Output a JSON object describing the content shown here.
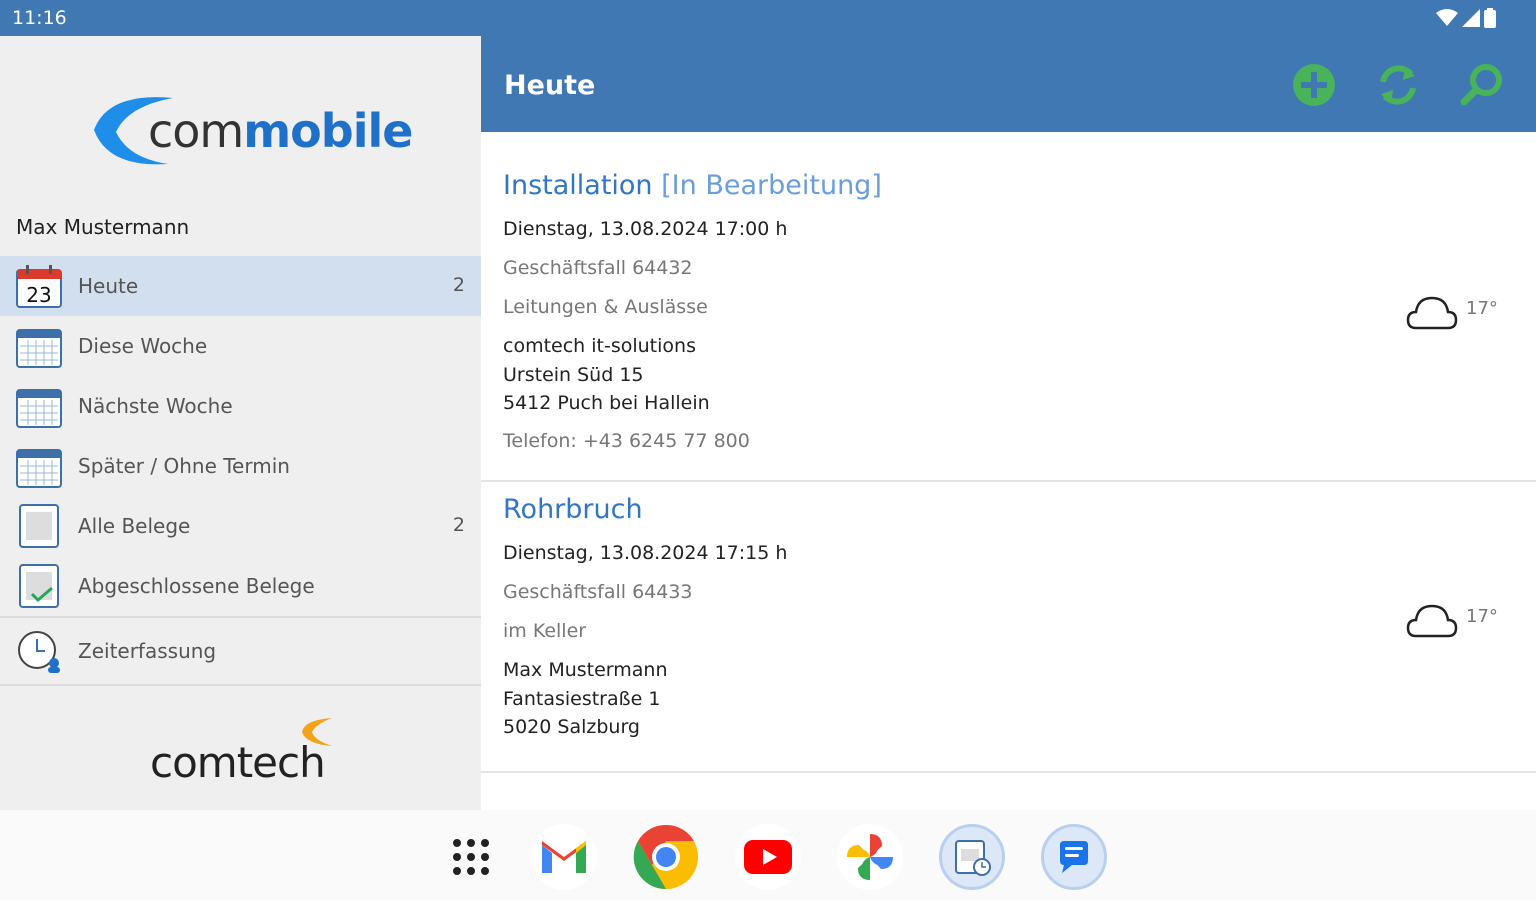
{
  "status": {
    "time": "11:16"
  },
  "drawer": {
    "logo_text_a": "com",
    "logo_text_b": "mobile",
    "user": "Max Mustermann",
    "items": [
      {
        "label": "Heute",
        "count": "2",
        "icon_day": "23",
        "active": true
      },
      {
        "label": "Diese Woche",
        "count": ""
      },
      {
        "label": "Nächste Woche",
        "count": ""
      },
      {
        "label": "Später / Ohne Termin",
        "count": ""
      },
      {
        "label": "Alle Belege",
        "count": "2"
      },
      {
        "label": "Abgeschlossene Belege",
        "count": ""
      }
    ],
    "zeit_label": "Zeiterfassung",
    "footer_logo": "comtech"
  },
  "appbar": {
    "title": "Heute",
    "add_icon": "add-circle-icon",
    "sync_icon": "sync-icon",
    "search_icon": "search-icon"
  },
  "cards": [
    {
      "title": "Installation",
      "state": "[In Bearbeitung]",
      "date": "Dienstag, 13.08.2024  17:00 h",
      "case": "Geschäftsfall 64432",
      "desc": "Leitungen & Auslässe",
      "company": "comtech it-solutions",
      "street": "Urstein Süd 15",
      "city": "5412 Puch bei Hallein",
      "phone": "Telefon: +43 6245 77 800",
      "temp": "17°"
    },
    {
      "title": "Rohrbruch",
      "date": "Dienstag, 13.08.2024  17:15 h",
      "case": "Geschäftsfall 64433",
      "desc": "im Keller",
      "company": "Max Mustermann",
      "street": "Fantasiestraße 1",
      "city": "5020 Salzburg",
      "temp": "17°"
    }
  ],
  "dock": [
    "apps-grid-icon",
    "gmail-icon",
    "chrome-icon",
    "youtube-icon",
    "photos-icon",
    "calendar-app-icon",
    "messages-icon"
  ]
}
